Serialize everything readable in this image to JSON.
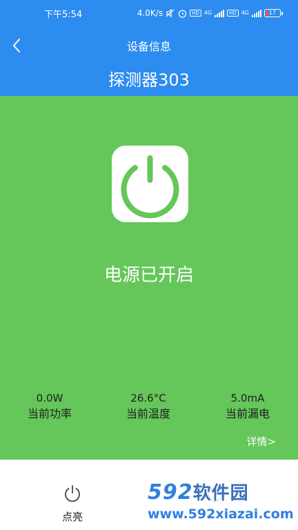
{
  "status_bar": {
    "time": "下午5:54",
    "network_speed": "4.0K/s",
    "icons": [
      "mute-icon",
      "alarm-icon",
      "hd-icon",
      "signal-4g-icon",
      "hd-icon",
      "signal-4g-icon"
    ],
    "hd_label": "HD",
    "net_label": "4G",
    "battery_level": "17"
  },
  "nav": {
    "back_icon": "chevron-left-icon",
    "title": "设备信息"
  },
  "device": {
    "name": "探测器303"
  },
  "power": {
    "icon": "power-icon",
    "status": "电源已开启"
  },
  "stats": [
    {
      "value": "0.0W",
      "label": "当前功率"
    },
    {
      "value": "26.6°C",
      "label": "当前温度"
    },
    {
      "value": "5.0mA",
      "label": "当前漏电"
    }
  ],
  "detail_link": "详情>",
  "bottom_actions": [
    {
      "icon": "power-icon",
      "label": "点亮"
    }
  ],
  "watermark": {
    "logo": "592",
    "logo_cn": "软件园",
    "url": "www.592xiazai.com"
  },
  "colors": {
    "header": "#2d8cf0",
    "panel": "#65c65a",
    "text_dark": "#1f1f1f",
    "watermark": "#2f7fe0"
  }
}
